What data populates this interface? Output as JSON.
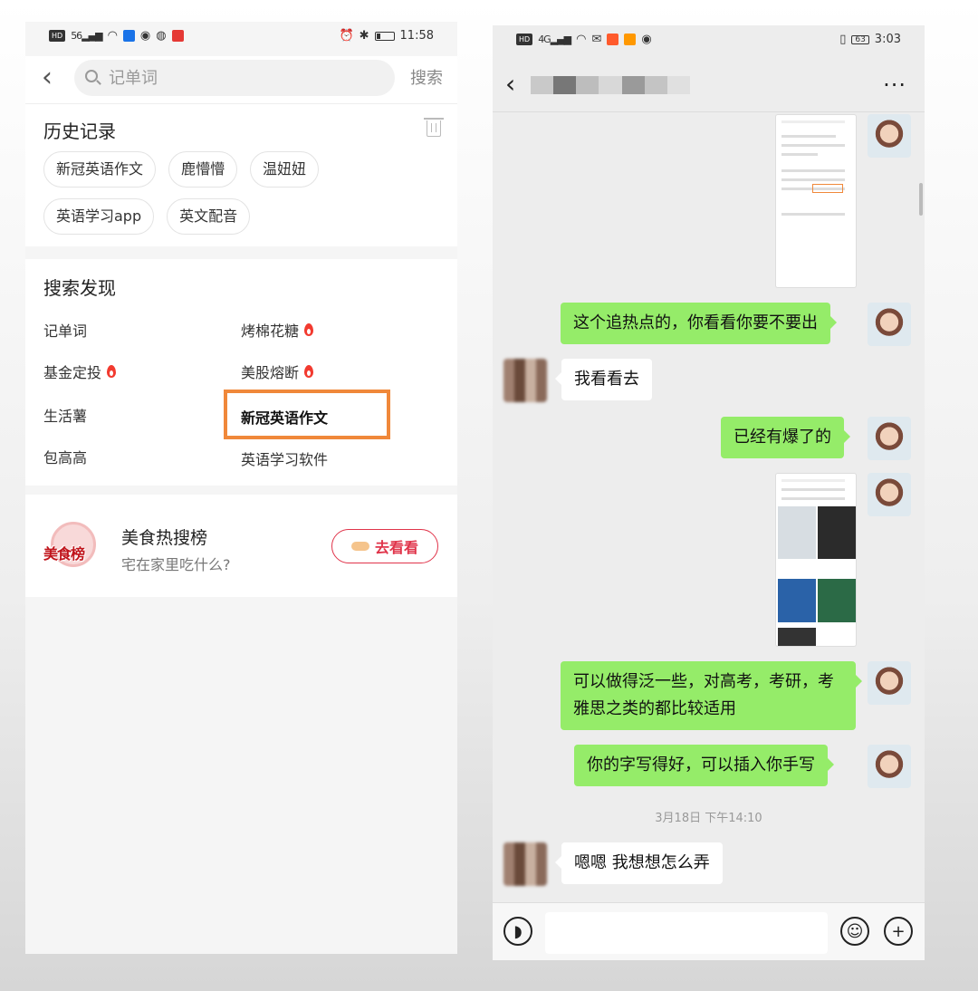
{
  "left": {
    "status": {
      "time": "11:58",
      "network": "56",
      "hd": "HD"
    },
    "search": {
      "placeholder": "记单词",
      "button": "搜索"
    },
    "history": {
      "title": "历史记录",
      "chips": [
        "新冠英语作文",
        "鹿懵懵",
        "温妞妞",
        "英语学习app",
        "英文配音"
      ]
    },
    "discover": {
      "title": "搜索发现",
      "items": [
        {
          "label": "记单词",
          "hot": false
        },
        {
          "label": "烤棉花糖",
          "hot": true
        },
        {
          "label": "基金定投",
          "hot": true
        },
        {
          "label": "美股熔断",
          "hot": true
        },
        {
          "label": "生活薯",
          "hot": false
        },
        {
          "label": "新冠英语作文",
          "hot": false,
          "highlighted": true
        },
        {
          "label": "包高高",
          "hot": false
        },
        {
          "label": "英语学习软件",
          "hot": false
        }
      ]
    },
    "food": {
      "logo_text": "美食榜",
      "title": "美食热搜榜",
      "subtitle": "宅在家里吃什么?",
      "button": "去看看"
    }
  },
  "right": {
    "status": {
      "time": "3:03",
      "battery": "63",
      "network": "4G",
      "hd": "HD"
    },
    "header": {
      "more": "···"
    },
    "messages": [
      {
        "from": "me",
        "type": "image"
      },
      {
        "from": "me",
        "type": "text",
        "text": "这个追热点的，你看看你要不要出"
      },
      {
        "from": "other",
        "type": "text",
        "text": "我看看去"
      },
      {
        "from": "me",
        "type": "text",
        "text": "已经有爆了的"
      },
      {
        "from": "me",
        "type": "image"
      },
      {
        "from": "me",
        "type": "text",
        "text": "可以做得泛一些，对高考，考研，考雅思之类的都比较适用"
      },
      {
        "from": "me",
        "type": "text",
        "text": "你的字写得好，可以插入你手写"
      },
      {
        "from": "other",
        "type": "text",
        "text": "嗯嗯 我想想怎么弄"
      }
    ],
    "timestamp": "3月18日 下午14:10"
  },
  "colors": {
    "highlight": "#f0883a",
    "bubble_me": "#95ec69",
    "hot": "#f23a2f",
    "accent_red": "#e0344a"
  },
  "icons": [
    "back-icon",
    "search-icon",
    "trash-icon",
    "flame-icon",
    "voice-icon",
    "emoji-icon",
    "plus-icon",
    "more-icon"
  ]
}
